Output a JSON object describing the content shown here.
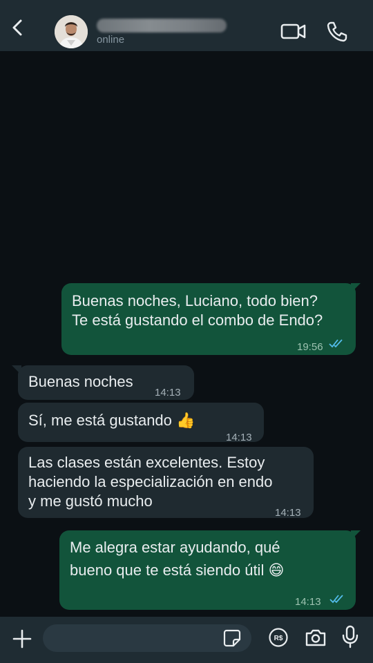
{
  "header": {
    "back_icon": "chevron-left-icon",
    "contact_name": "",
    "status": "online",
    "video_icon": "video-camera-icon",
    "call_icon": "phone-icon"
  },
  "messages": [
    {
      "direction": "outgoing",
      "lines": [
        "Buenas noches, Luciano, todo bien?",
        "Te está gustando el combo de Endo?"
      ],
      "time": "19:56",
      "status": "read"
    },
    {
      "direction": "incoming",
      "lines": [
        "Buenas noches"
      ],
      "time": "14:13"
    },
    {
      "direction": "incoming",
      "lines": [
        "Sí, me está gustando 👍"
      ],
      "time": "14:13"
    },
    {
      "direction": "incoming",
      "lines": [
        "Las clases están excelentes. Estoy",
        "haciendo la especialización en endo",
        "y me gustó mucho"
      ],
      "time": "14:13"
    },
    {
      "direction": "outgoing",
      "lines": [
        "Me alegra estar ayudando, qué",
        "bueno que te está siendo útil 😄"
      ],
      "time": "14:13",
      "status": "read"
    }
  ],
  "composer": {
    "plus_icon": "plus-icon",
    "input_value": "",
    "sticker_icon": "sticker-icon",
    "payment_icon": "payment-icon",
    "camera_icon": "camera-icon",
    "mic_icon": "microphone-icon"
  },
  "colors": {
    "background": "#0b1014",
    "header": "#1f2c33",
    "outgoing_bubble": "#12543b",
    "incoming_bubble": "#1f2a30",
    "read_ticks": "#53bdeb"
  }
}
